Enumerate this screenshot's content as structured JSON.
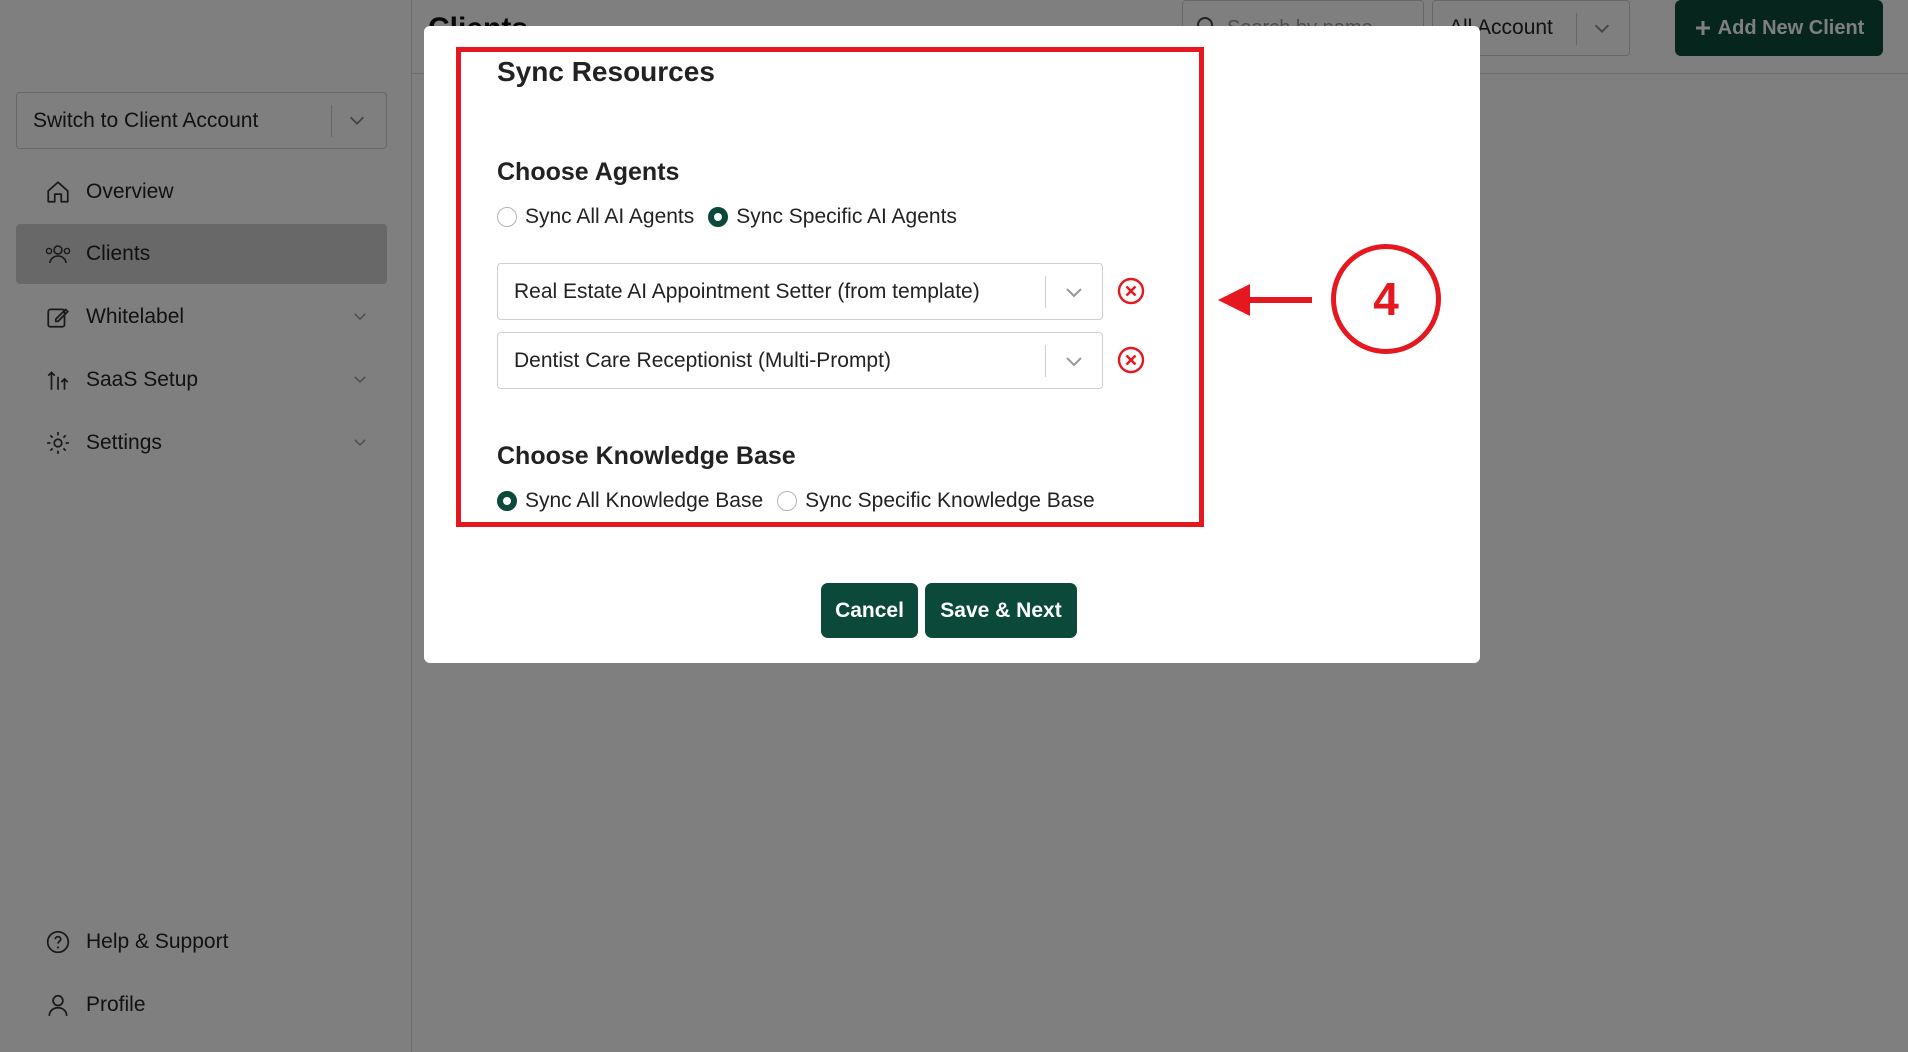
{
  "app": {
    "page_title": "Clients",
    "account_switcher": {
      "label": "Switch to Client Account"
    },
    "nav": [
      {
        "label": "Overview",
        "icon": "home-icon"
      },
      {
        "label": "Clients",
        "icon": "users-icon"
      },
      {
        "label": "Whitelabel",
        "icon": "edit-icon"
      },
      {
        "label": "SaaS Setup",
        "icon": "saas-icon"
      },
      {
        "label": "Settings",
        "icon": "gear-icon"
      }
    ],
    "bottom_nav": [
      {
        "label": "Help & Support",
        "icon": "help-icon"
      },
      {
        "label": "Profile",
        "icon": "user-icon"
      }
    ],
    "header": {
      "search_placeholder": "Search by name",
      "account_filter": "All Account",
      "add_button": "Add New Client"
    }
  },
  "modal": {
    "title": "Sync Resources",
    "agents": {
      "heading": "Choose Agents",
      "options": [
        {
          "label": "Sync All AI Agents",
          "checked": false
        },
        {
          "label": "Sync Specific AI Agents",
          "checked": true
        }
      ],
      "selected": [
        "Real Estate AI Appointment Setter (from template)",
        "Dentist Care Receptionist (Multi-Prompt)"
      ]
    },
    "knowledge_base": {
      "heading": "Choose Knowledge Base",
      "options": [
        {
          "label": "Sync All Knowledge Base",
          "checked": true
        },
        {
          "label": "Sync Specific Knowledge Base",
          "checked": false
        }
      ]
    },
    "buttons": {
      "cancel": "Cancel",
      "save": "Save & Next"
    }
  },
  "annotation": {
    "step_number": "4",
    "color": "#e5171f"
  },
  "colors": {
    "primary": "#0b4a3a",
    "annotation": "#e5171f"
  }
}
